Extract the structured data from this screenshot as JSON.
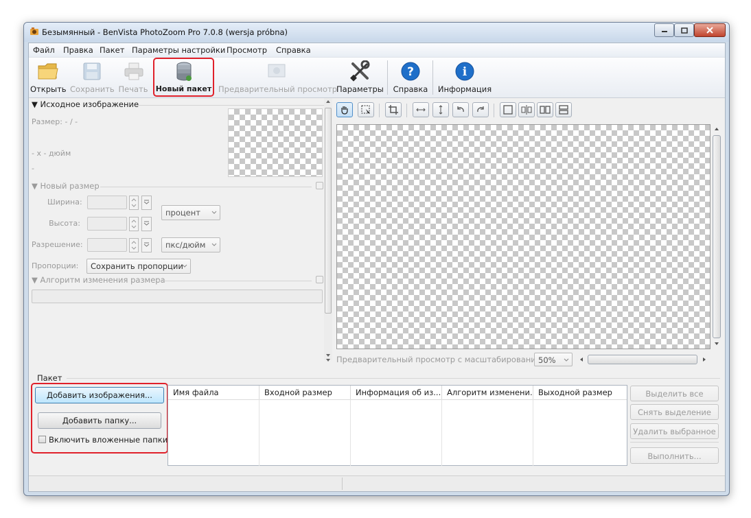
{
  "window": {
    "title": "Безымянный - BenVista PhotoZoom Pro 7.0.8 (wersja próbna)"
  },
  "menu": [
    "Файл",
    "Правка",
    "Пакет",
    "Параметры настройки",
    "Просмотр",
    "Справка"
  ],
  "toolbar": {
    "open": "Открыть",
    "save": "Сохранить",
    "print": "Печать",
    "new_batch": "Новый пакет",
    "preview": "Предварительный просмотр",
    "settings": "Параметры",
    "help": "Справка",
    "info": "Информация"
  },
  "source_panel": {
    "title": "Исходное изображение",
    "size": "Размер: - / -",
    "dims": "- x - дюйм",
    "extra": "-"
  },
  "new_size": {
    "title": "Новый размер",
    "width_label": "Ширина:",
    "height_label": "Высота:",
    "resolution_label": "Разрешение:",
    "unit_size": "процент",
    "unit_res": "пкс/дюйм",
    "proportions_label": "Пропорции:",
    "proportions_value": "Сохранить пропорции"
  },
  "algorithm": {
    "title": "Алгоритм изменения размера"
  },
  "preview": {
    "zoom_label": "Предварительный просмотр с масштабированием:",
    "zoom_value": "50%"
  },
  "batch": {
    "title": "Пакет",
    "add_images": "Добавить изображения...",
    "add_folder": "Добавить папку...",
    "include_subfolders": "Включить вложенные папки",
    "columns": [
      "Имя файла",
      "Входной размер",
      "Информация об из...",
      "Алгоритм изменени...",
      "Выходной размер"
    ],
    "select_all": "Выделить все",
    "deselect": "Снять выделение",
    "delete_selected": "Удалить выбранное",
    "run": "Выполнить..."
  },
  "colors": {
    "highlight": "#e0202a",
    "help_icon": "#1f6fc9",
    "window_frame": "#cfdcea"
  }
}
